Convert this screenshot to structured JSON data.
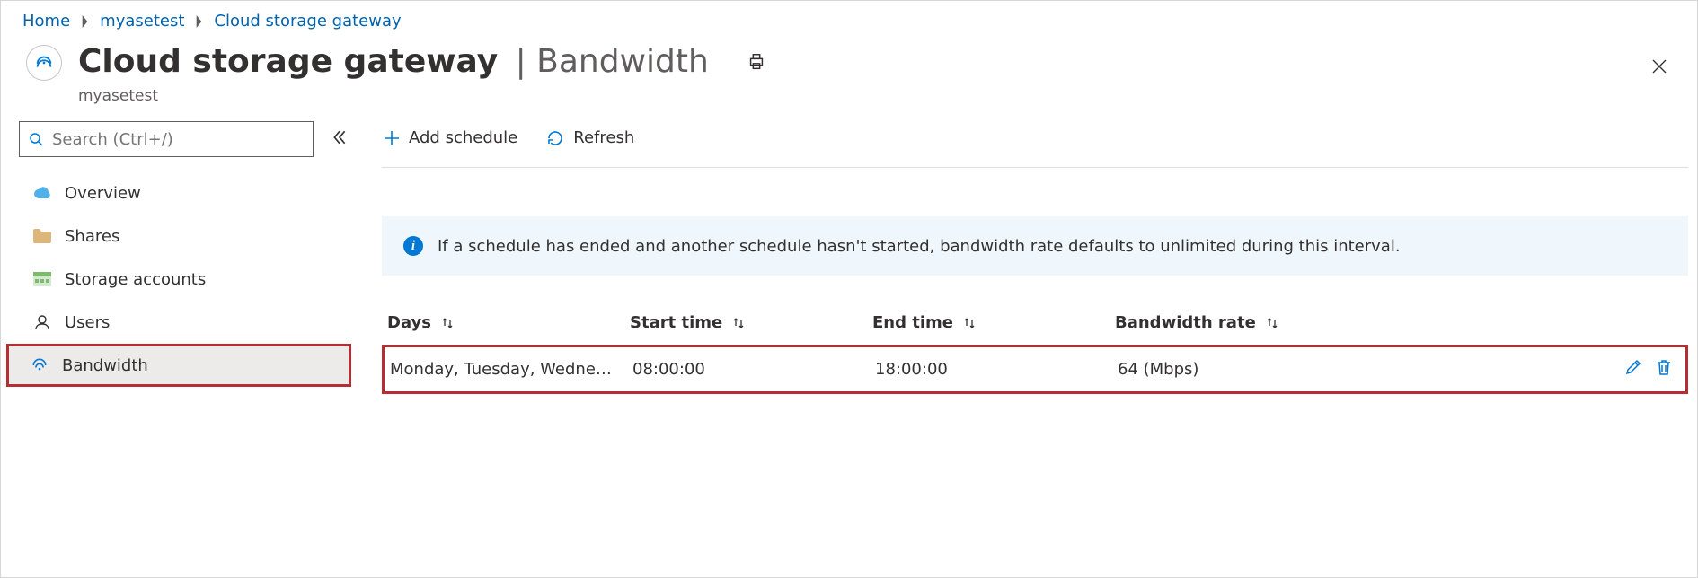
{
  "breadcrumbs": [
    {
      "label": "Home"
    },
    {
      "label": "myasetest"
    },
    {
      "label": "Cloud storage gateway"
    }
  ],
  "header": {
    "title": "Cloud storage gateway",
    "section": "Bandwidth",
    "resource": "myasetest"
  },
  "search": {
    "placeholder": "Search (Ctrl+/)"
  },
  "sidebar": {
    "items": [
      {
        "label": "Overview",
        "icon": "cloud-icon"
      },
      {
        "label": "Shares",
        "icon": "folder-icon"
      },
      {
        "label": "Storage accounts",
        "icon": "storage-icon"
      },
      {
        "label": "Users",
        "icon": "user-icon"
      },
      {
        "label": "Bandwidth",
        "icon": "bandwidth-icon",
        "selected": true,
        "highlighted": true
      }
    ]
  },
  "toolbar": {
    "add_schedule": "Add schedule",
    "refresh": "Refresh"
  },
  "info": {
    "text": "If a schedule has ended and another schedule hasn't started, bandwidth rate defaults to unlimited during this interval."
  },
  "table": {
    "columns": {
      "days": "Days",
      "start": "Start time",
      "end": "End time",
      "rate": "Bandwidth rate"
    },
    "rows": [
      {
        "days": "Monday, Tuesday, Wednesd…",
        "start": "08:00:00",
        "end": "18:00:00",
        "rate": "64 (Mbps)"
      }
    ]
  }
}
